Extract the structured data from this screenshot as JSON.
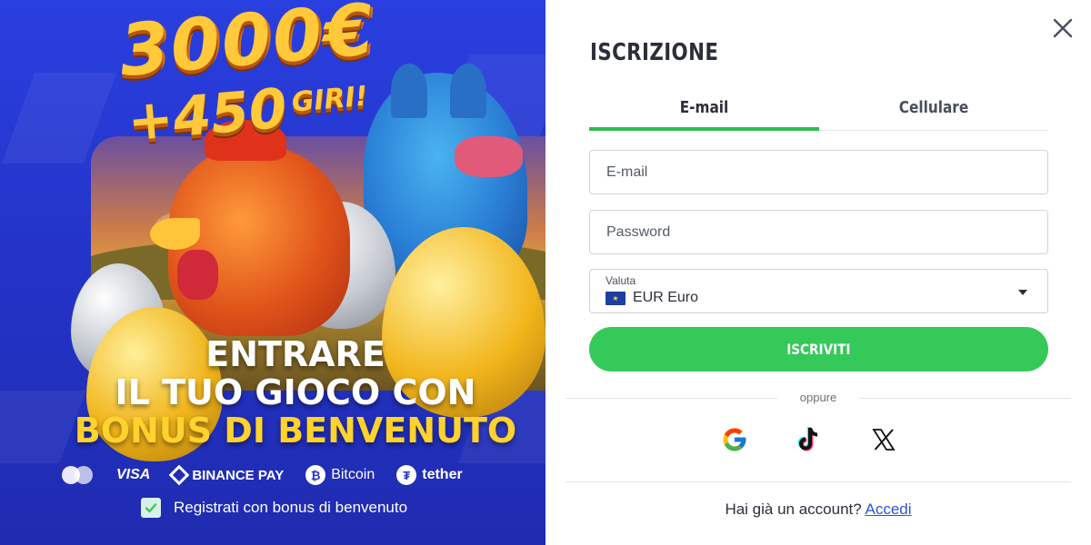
{
  "promo": {
    "amount": "3000€",
    "spins": "+450",
    "spins_suffix": "GIRI!",
    "tagline_line1": "ENTRARE",
    "tagline_line2": "IL TUO GIOCO CON",
    "tagline_line3": "BONUS DI BENVENUTO",
    "payments": [
      {
        "name": "mastercard-icon",
        "label": ""
      },
      {
        "name": "visa",
        "label": "VISA"
      },
      {
        "name": "binance-pay",
        "label": "BINANCE PAY"
      },
      {
        "name": "bitcoin",
        "label": "Bitcoin"
      },
      {
        "name": "tether",
        "label": "tether"
      }
    ],
    "bonus_checkbox_label": "Registrati con bonus di benvenuto",
    "bonus_checked": true,
    "colors": {
      "background": "#2434c9",
      "highlight": "#ffd22e",
      "gold": "#ffc93a"
    }
  },
  "form": {
    "title": "ISCRIZIONE",
    "tabs": [
      {
        "label": "E-mail",
        "active": true
      },
      {
        "label": "Cellulare",
        "active": false
      }
    ],
    "email_placeholder": "E-mail",
    "password_placeholder": "Password",
    "currency_label": "Valuta",
    "currency_value": "EUR Euro",
    "submit_label": "ISCRIVITI",
    "or_text": "oppure",
    "socials": [
      "google-icon",
      "tiktok-icon",
      "x-icon"
    ],
    "have_account_text": "Hai già un account?",
    "login_link": "Accedi",
    "colors": {
      "accent": "#35c95a",
      "link": "#2a56d6",
      "text": "#2b2f3a"
    }
  }
}
